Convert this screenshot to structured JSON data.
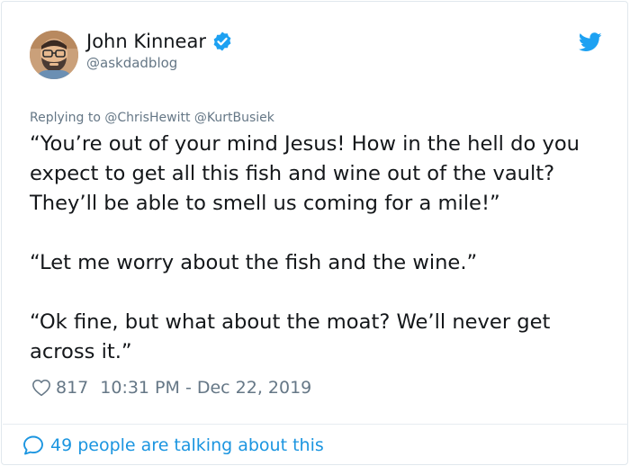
{
  "author": {
    "name": "John Kinnear",
    "handle": "@askdadblog",
    "verified": true,
    "avatar_icon": "bearded-man-with-glasses-avatar"
  },
  "brand": {
    "icon": "twitter-bird-icon",
    "color": "#1da1f2"
  },
  "reply_context": {
    "prefix": "Replying to",
    "mentions": [
      "@ChrisHewitt",
      "@KurtBusiek"
    ]
  },
  "tweet": {
    "paragraphs": [
      "“You’re out of your mind Jesus! How in the hell do you expect to get all this fish and wine out of the vault? They’ll be able to smell us coming for a mile!”",
      "“Let me worry about the fish and the wine.”",
      "“Ok fine, but what about the moat? We’ll never get across it.”"
    ]
  },
  "meta": {
    "like_icon": "heart-outline-icon",
    "like_count": "817",
    "timestamp": "10:31 PM - Dec 22, 2019"
  },
  "footer": {
    "icon": "speech-bubble-icon",
    "talking_text": "49 people are talking about this",
    "link_color": "#1b95e0"
  }
}
